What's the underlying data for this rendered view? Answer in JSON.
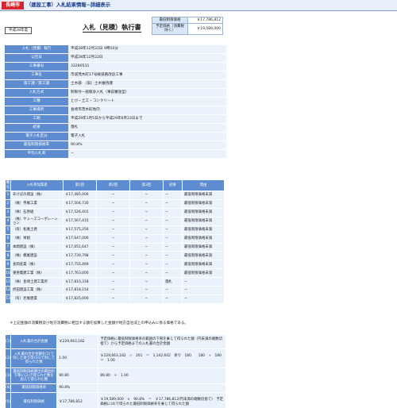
{
  "header": {
    "city": "長崎市",
    "title": "（建設工事）入札結果情報−詳細表示"
  },
  "era_badge": "平成28年度",
  "doc_title": "入札（見積）執行書",
  "price_box": {
    "rows": [
      {
        "label": "最低制限価格",
        "value": "￥17,786,812"
      },
      {
        "label": "予定価格（消費税除く）",
        "value": "￥19,589,000"
      }
    ]
  },
  "info": [
    {
      "label": "入札（見積）執行",
      "value": "平成28年12月22日 9時10分"
    },
    {
      "label": "公告日",
      "value": "平成28年12月22日"
    },
    {
      "label": "工事番号",
      "value": "33280531"
    },
    {
      "label": "工事名",
      "value": "市道茂木町17号線道路改良工事"
    },
    {
      "label": "施工課／施工課",
      "value": "土木部　（旧）土木維持課"
    },
    {
      "label": "入札方式",
      "value": "制限付一般競争入札（事前審査型）"
    },
    {
      "label": "工種",
      "value": "とび・土工・コンクリート"
    },
    {
      "label": "工事場所",
      "value": "長崎市茂木町地内"
    },
    {
      "label": "工期",
      "value": "平成29年1月5日から平成29年6月23日まで"
    },
    {
      "label": "結果",
      "value": "落札"
    },
    {
      "label": "電子入札区分",
      "value": "電子入札"
    },
    {
      "label": "最低制限価格率",
      "value": "90.8%"
    },
    {
      "label": "平均入札率",
      "value": "−"
    }
  ],
  "bids": {
    "headers": [
      "番号",
      "入札参加業者",
      "第1回",
      "第2回",
      "第3回",
      "結果",
      "理由"
    ],
    "rows": [
      {
        "no": "1",
        "name": "あけぼの建設（株）",
        "r1": "￥17,485,000",
        "r2": "−",
        "r3": "−",
        "result": "−",
        "reason": "最低制限価格未満"
      },
      {
        "no": "2",
        "name": "（株）寺尾工業",
        "r1": "￥17,504,730",
        "r2": "−",
        "r3": "−",
        "result": "−",
        "reason": "最低制限価格未満"
      },
      {
        "no": "3",
        "name": "（株）石原組",
        "r1": "￥17,526,401",
        "r2": "−",
        "r3": "−",
        "result": "−",
        "reason": "最低制限価格未満"
      },
      {
        "no": "4",
        "name": "（株）サミーズコーポレーション",
        "r1": "￥17,567,415",
        "r2": "−",
        "r3": "−",
        "result": "−",
        "reason": "最低制限価格未満"
      },
      {
        "no": "5",
        "name": "（有）松尾土建",
        "r1": "￥17,575,250",
        "r2": "−",
        "r3": "−",
        "result": "−",
        "reason": "最低制限価格未満"
      },
      {
        "no": "6",
        "name": "（株）栄組",
        "r1": "￥17,647,000",
        "r2": "−",
        "r3": "−",
        "result": "−",
        "reason": "最低制限価格未満"
      },
      {
        "no": "7",
        "name": "本間建設（株）",
        "r1": "￥17,651,647",
        "r2": "−",
        "r3": "−",
        "result": "−",
        "reason": "最低制限価格未満"
      },
      {
        "no": "8",
        "name": "（株）橋尾建設",
        "r1": "￥17,739,798",
        "r2": "−",
        "r3": "−",
        "result": "−",
        "reason": "最低制限価格未満"
      },
      {
        "no": "9",
        "name": "長岡産業（株）",
        "r1": "￥17,755,469",
        "r2": "−",
        "r3": "−",
        "result": "−",
        "reason": "最低制限価格未満"
      },
      {
        "no": "10",
        "name": "東亜電建工業（株）",
        "r1": "￥17,763,000",
        "r2": "−",
        "r3": "−",
        "result": "−",
        "reason": "最低制限価格未満"
      },
      {
        "no": "11",
        "name": "（株）長崎土建工業所",
        "r1": "￥17,810,318",
        "r2": "−",
        "r3": "−",
        "result": "落札",
        "reason": "−"
      },
      {
        "no": "12",
        "name": "折田建設工業（株）",
        "r1": "￥17,818,154",
        "r2": "−",
        "r3": "−",
        "result": "−",
        "reason": "−"
      },
      {
        "no": "13",
        "name": "（有）岩尾建業",
        "r1": "￥17,825,000",
        "r2": "−",
        "r3": "−",
        "result": "−",
        "reason": "−"
      }
    ]
  },
  "note": "＊上記金額の消費税及び地方消費税に相当する額を加算した金額が地方自治法上の申込みに係る価格である。",
  "calc": [
    {
      "no": "(1)",
      "label": "入札書の合計金額",
      "value": "￥229,663,182",
      "desc": "予定価格に最低制限価格率の範囲の下限を乗じて得られた額（円未満の端数切捨て）から予定価格までの入札書の合計金額"
    },
    {
      "no": "(2)",
      "label": "入札書の合計金額を(1)で除した余り等(10)で除して得られた数",
      "value": "1.00",
      "desc": "￥229,663,182　÷　201　＝　1,142,602　余り　180　　180　÷　180　＝　1.00"
    },
    {
      "no": "(3)",
      "label": "最低制限価格算出の範囲の下限に(2)で得られた数を加えて得られた数",
      "value": "90.80",
      "desc": "89.80　＋　1.00"
    },
    {
      "no": "(4)",
      "label": "最低制限価格率",
      "value": "90.8%",
      "desc": ""
    },
    {
      "no": "(5)",
      "label": "最低制限価格",
      "value": "￥17,786,812",
      "desc": "￥19,589,000　×　90.8%　＝　￥17,786,812(円未満の端数切捨て)　予定価格に(4)で得られた最低制限価格率を乗じて得られた額"
    }
  ]
}
